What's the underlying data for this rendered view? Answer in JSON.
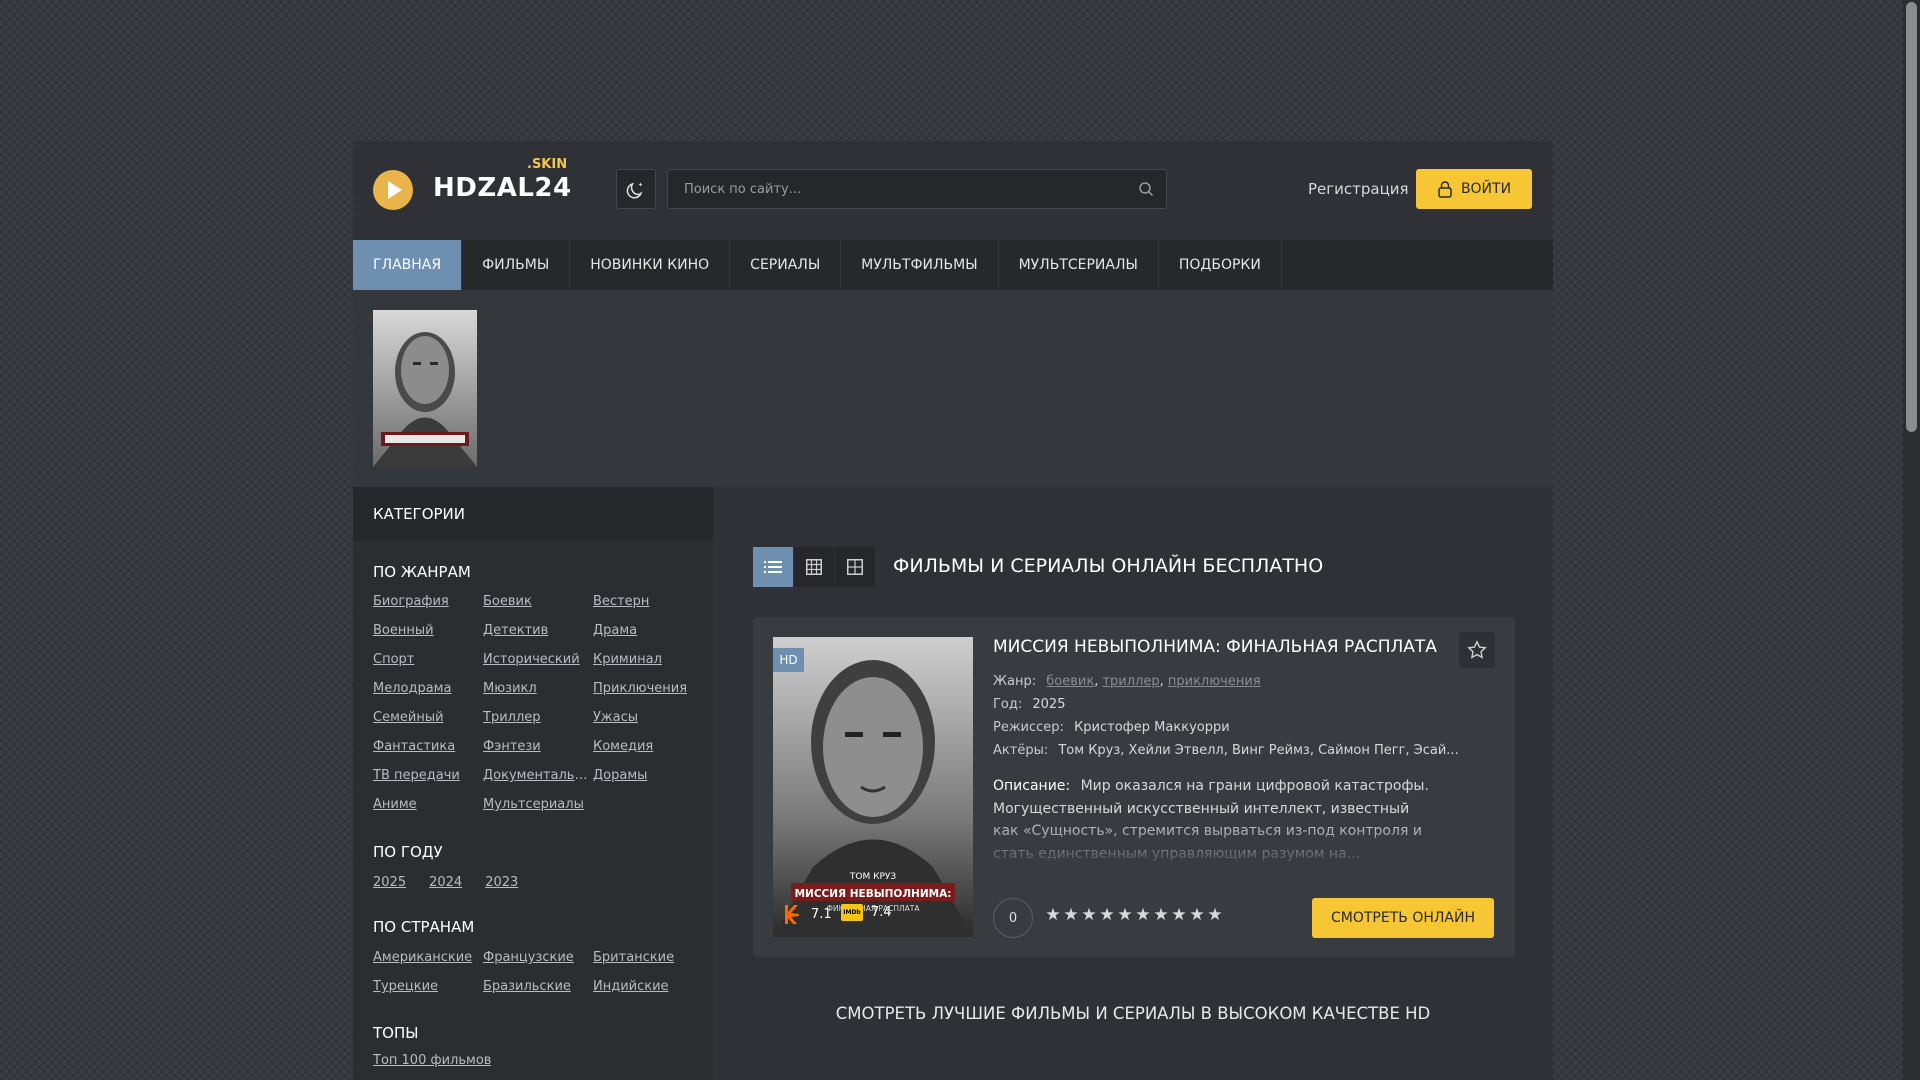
{
  "header": {
    "logo_sub": ".SKIN",
    "logo_text": "HDZAL24",
    "search_placeholder": "Поиск по сайту...",
    "register_label": "Регистрация",
    "login_label": "ВОЙТИ"
  },
  "nav": {
    "items": [
      {
        "label": "ГЛАВНАЯ",
        "active": true
      },
      {
        "label": "ФИЛЬМЫ"
      },
      {
        "label": "НОВИНКИ КИНО"
      },
      {
        "label": "СЕРИАЛЫ"
      },
      {
        "label": "МУЛЬТФИЛЬМЫ"
      },
      {
        "label": "МУЛЬТСЕРИАЛЫ"
      },
      {
        "label": "ПОДБОРКИ"
      }
    ]
  },
  "sidebar": {
    "heading": "КАТЕГОРИИ",
    "by_genre_title": "ПО ЖАНРАМ",
    "genres": [
      "Биография",
      "Боевик",
      "Вестерн",
      "Военный",
      "Детектив",
      "Драма",
      "Спорт",
      "Исторический",
      "Криминал",
      "Мелодрама",
      "Мюзикл",
      "Приключения",
      "Семейный",
      "Триллер",
      "Ужасы",
      "Фантастика",
      "Фэнтези",
      "Комедия",
      "ТВ передачи",
      "Документальные",
      "Дорамы",
      "Аниме",
      "Мультсериалы"
    ],
    "by_year_title": "ПО ГОДУ",
    "years": [
      "2025",
      "2024",
      "2023"
    ],
    "by_country_title": "ПО СТРАНАМ",
    "countries": [
      "Американские",
      "Французские",
      "Британские",
      "Турецкие",
      "Бразильские",
      "Индийские"
    ],
    "tops_title": "ТОПЫ",
    "tops_link": "Топ 100 фильмов"
  },
  "main": {
    "title": "ФИЛЬМЫ И СЕРИАЛЫ ОНЛАЙН БЕСПЛАТНО",
    "bottom_title": "СМОТРЕТЬ ЛУЧШИЕ ФИЛЬМЫ И СЕРИАЛЫ В ВЫСОКОМ КАЧЕСТВЕ HD",
    "card": {
      "badge": "HD",
      "title": "МИССИЯ НЕВЫПОЛНИМА: ФИНАЛЬНАЯ РАСПЛАТА",
      "genre_label": "Жанр:",
      "genres": [
        "боевик",
        "триллер",
        "приключения"
      ],
      "year_label": "Год:",
      "year": "2025",
      "director_label": "Режиссер:",
      "director": "Кристофер Маккуорри",
      "actors_label": "Актёры:",
      "actors": "Том Круз, Хейли Этвелл, Винг Реймз, Саймон Пегг, Эсай...",
      "desc_label": "Описание:",
      "description": "Мир оказался на грани цифровой катастрофы. Могущественный искусственный интеллект, известный как «Сущность», стремится вырваться из-под контроля и стать единственным управляющим разумом на...",
      "kp_rating": "7.1",
      "imdb_rating": "7.4",
      "imdb_logo": "IMDb",
      "votes": "0",
      "watch_label": "СМОТРЕТЬ ОНЛАЙН",
      "poster_lines": [
        "ТОМ КРУЗ",
        "МИССИЯ НЕВЫПОЛНИМА:",
        "ФИНАЛЬНАЯ РАСПЛАТА"
      ]
    }
  },
  "colors": {
    "accent": "#f7c634",
    "nav_active": "#6f8fb0",
    "panel": "#2f3136"
  }
}
